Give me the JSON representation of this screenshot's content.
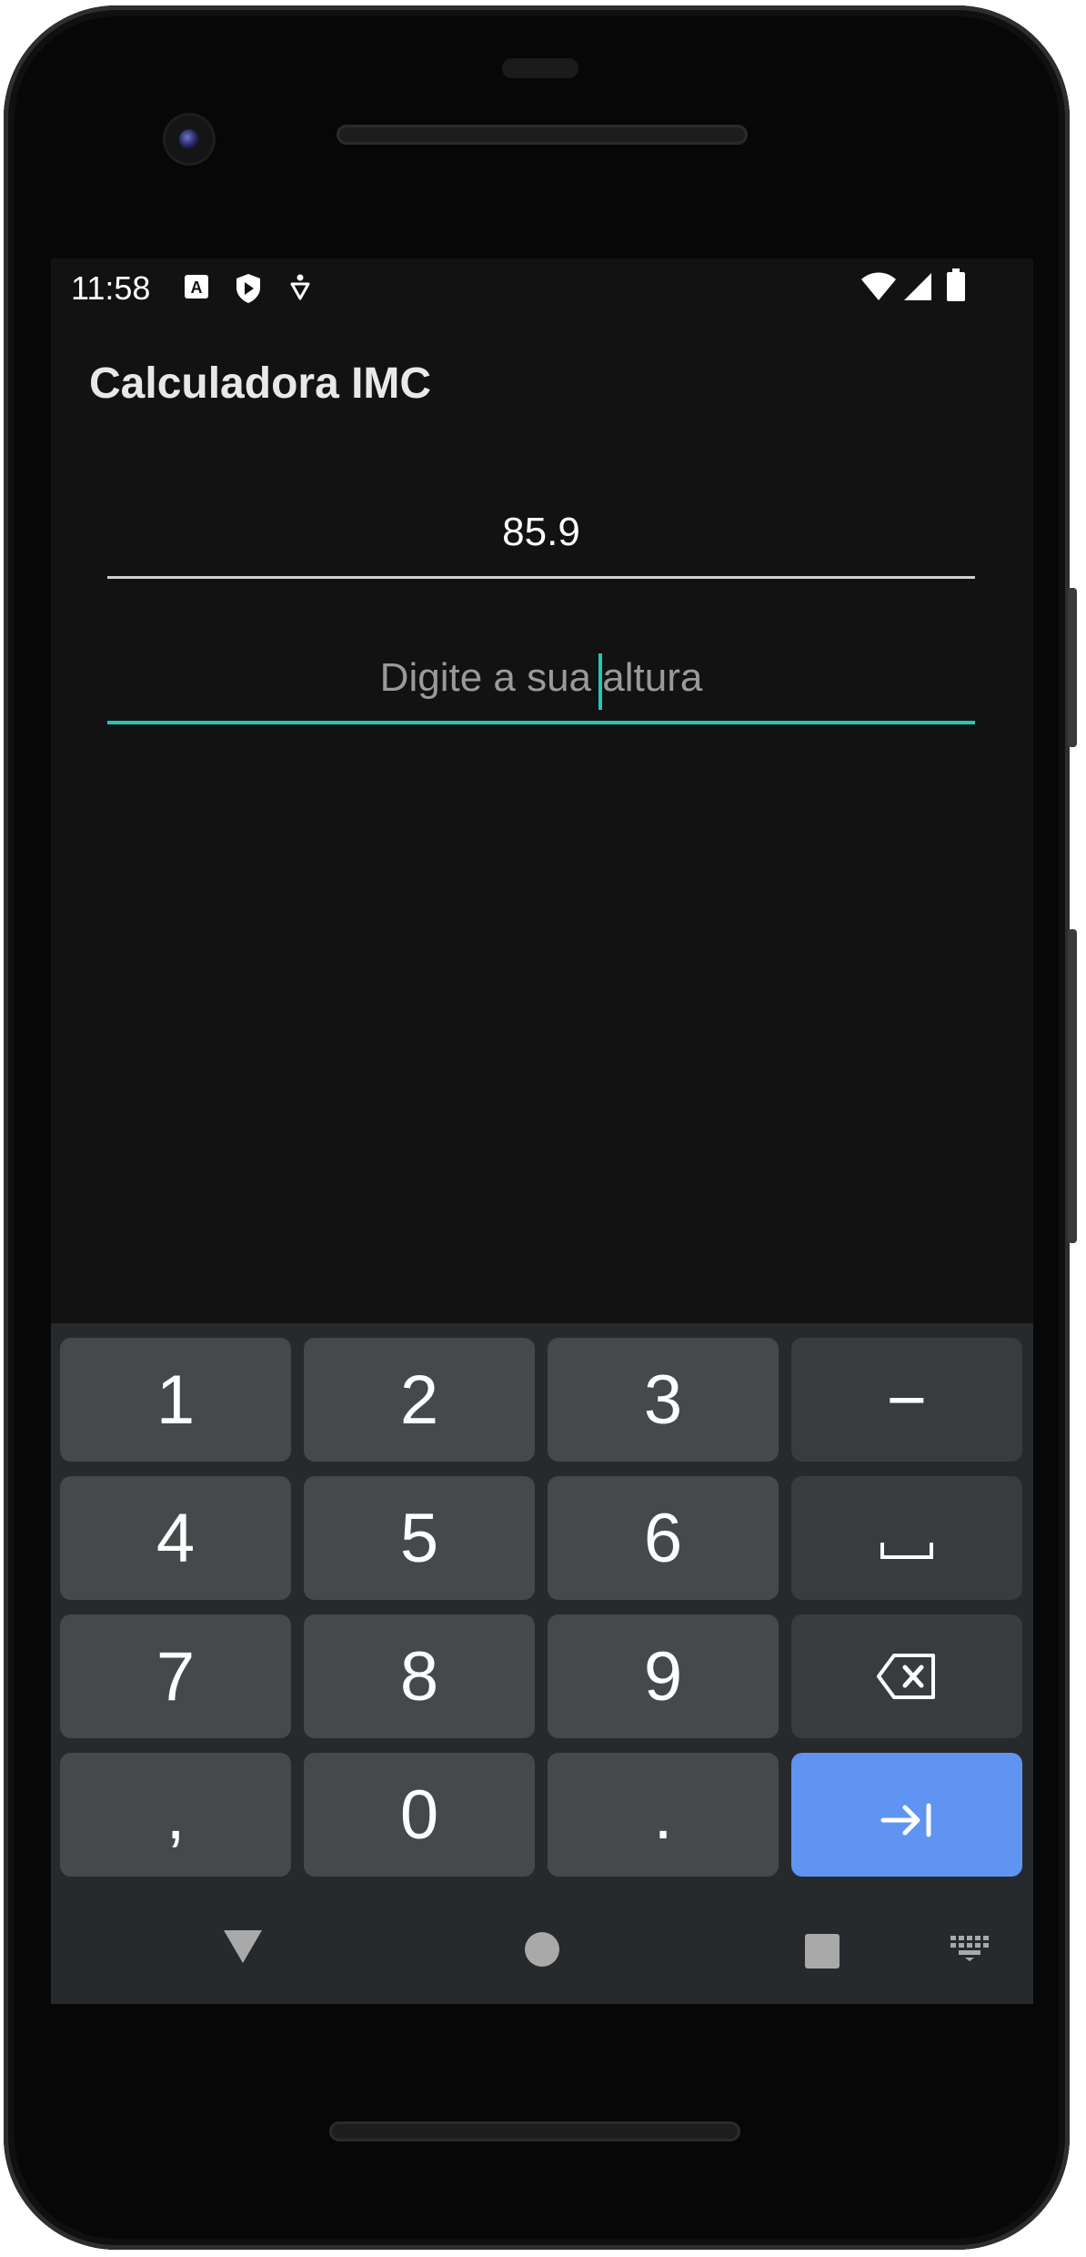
{
  "status_bar": {
    "time": "11:58",
    "left_icons": [
      "text-a-icon",
      "play-protect-icon",
      "accessibility-icon"
    ],
    "right_icons": [
      "wifi-icon",
      "cell-signal-icon",
      "battery-icon"
    ]
  },
  "app": {
    "title": "Calculadora IMC"
  },
  "form": {
    "weight_value": "85.9",
    "height_value": "",
    "height_placeholder": "Digite a sua altura"
  },
  "keyboard": {
    "keys": [
      "1",
      "2",
      "3",
      "−",
      "4",
      "5",
      "6",
      "space-icon",
      "7",
      "8",
      "9",
      "backspace-icon",
      ",",
      "0",
      ".",
      "next-field-icon"
    ],
    "key_1": "1",
    "key_2": "2",
    "key_3": "3",
    "key_minus": "−",
    "key_4": "4",
    "key_5": "5",
    "key_6": "6",
    "key_7": "7",
    "key_8": "8",
    "key_9": "9",
    "key_comma": ",",
    "key_0": "0",
    "key_dot": "."
  },
  "nav_bar": {
    "icons": [
      "back-icon",
      "home-icon",
      "recents-icon",
      "keyboard-switch-icon"
    ]
  },
  "colors": {
    "screen_background": "#121212",
    "accent": "#26c6b4",
    "enter_key": "#5f94f2",
    "key": "#45494c",
    "keyboard_background": "#262a2d"
  }
}
